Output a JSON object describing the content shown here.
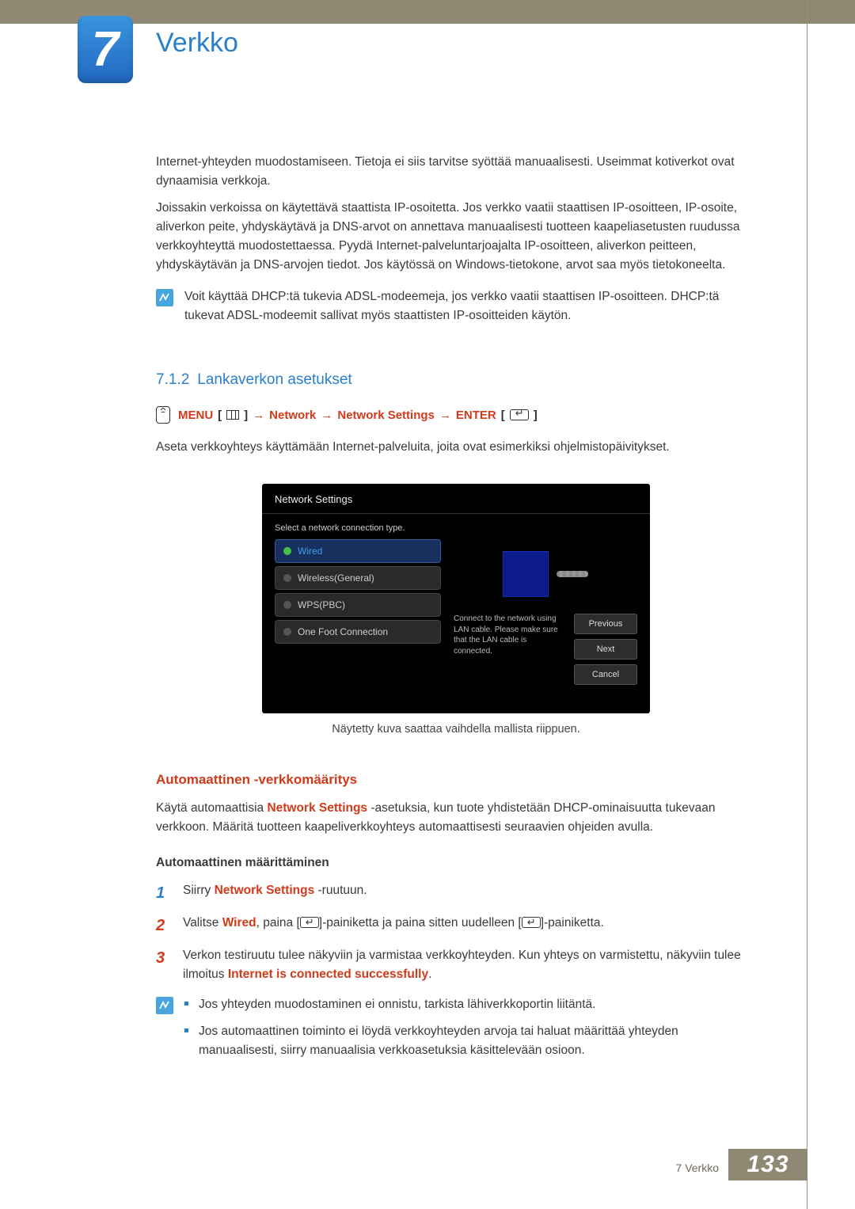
{
  "chapter": {
    "number": "7",
    "title": "Verkko"
  },
  "intro": {
    "para1": "Internet-yhteyden muodostamiseen. Tietoja ei siis tarvitse syöttää manuaalisesti. Useimmat kotiverkot ovat dynaamisia verkkoja.",
    "para2": "Joissakin verkoissa on käytettävä staattista IP-osoitetta. Jos verkko vaatii staattisen IP-osoitteen, IP-osoite, aliverkon peite, yhdyskäytävä ja DNS-arvot on annettava manuaalisesti tuotteen kaapeliasetusten ruudussa verkkoyhteyttä muodostettaessa. Pyydä Internet-palveluntarjoajalta IP-osoitteen, aliverkon peitteen, yhdyskäytävän ja DNS-arvojen tiedot. Jos käytössä on Windows-tietokone, arvot saa myös tietokoneelta.",
    "note": "Voit käyttää DHCP:tä tukevia ADSL-modeemeja, jos verkko vaatii staattisen IP-osoitteen. DHCP:tä tukevat ADSL-modeemit sallivat myös staattisten IP-osoitteiden käytön."
  },
  "section": {
    "number": "7.1.2",
    "title": "Lankaverkon asetukset",
    "menu": {
      "label_menu": "MENU",
      "path1": "Network",
      "path2": "Network Settings",
      "label_enter": "ENTER"
    },
    "lead": "Aseta verkkoyhteys käyttämään Internet-palveluita, joita ovat esimerkiksi ohjelmistopäivitykset."
  },
  "dialog": {
    "title": "Network Settings",
    "subtitle": "Select a network connection type.",
    "items": [
      "Wired",
      "Wireless(General)",
      "WPS(PBC)",
      "One Foot Connection"
    ],
    "help": "Connect to the network using LAN cable. Please make sure that the LAN cable is connected.",
    "buttons": {
      "previous": "Previous",
      "next": "Next",
      "cancel": "Cancel"
    },
    "caption": "Näytetty kuva saattaa vaihdella mallista riippuen."
  },
  "auto": {
    "heading": "Automaattinen -verkkomääritys",
    "body_a": "Käytä automaattisia ",
    "body_red": "Network Settings",
    "body_b": " -asetuksia, kun tuote yhdistetään DHCP-ominaisuutta tukevaan verkkoon. Määritä tuotteen kaapeliverkkoyhteys automaattisesti seuraavien ohjeiden avulla.",
    "subheading": "Automaattinen määrittäminen",
    "steps": {
      "s1a": "Siirry ",
      "s1b": "Network Settings",
      "s1c": " -ruutuun.",
      "s2a": "Valitse ",
      "s2b": "Wired",
      "s2c": ", paina [",
      "s2d": "]-painiketta ja paina sitten uudelleen [",
      "s2e": "]-painiketta.",
      "s3a": "Verkon testiruutu tulee näkyviin ja varmistaa verkkoyhteyden. Kun yhteys on varmistettu, näkyviin tulee ilmoitus ",
      "s3b": "Internet is connected successfully",
      "s3c": "."
    },
    "notes": {
      "b1": "Jos yhteyden muodostaminen ei onnistu, tarkista lähiverkkoportin liitäntä.",
      "b2": "Jos automaattinen toiminto ei löydä verkkoyhteyden arvoja tai haluat määrittää yhteyden manuaalisesti, siirry manuaalisia verkkoasetuksia käsittelevään osioon."
    }
  },
  "footer": {
    "label": "7 Verkko",
    "page": "133"
  }
}
